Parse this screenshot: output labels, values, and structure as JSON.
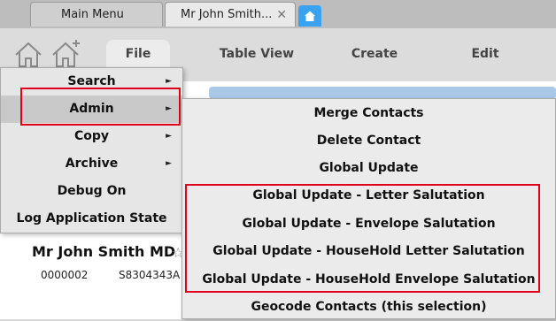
{
  "tabs": [
    {
      "label": "Main Menu"
    },
    {
      "label": "Mr John Smith...",
      "close": "✕"
    }
  ],
  "toolbar": {
    "menus": [
      "File",
      "Table View",
      "Create",
      "Edit"
    ]
  },
  "file_menu": {
    "items": [
      {
        "label": "Search"
      },
      {
        "label": "Admin"
      },
      {
        "label": "Copy"
      },
      {
        "label": "Archive"
      },
      {
        "label": "Debug On"
      },
      {
        "label": "Log Application State"
      }
    ],
    "submenu_arrow": "►"
  },
  "admin_submenu": {
    "items": [
      {
        "label": "Merge Contacts"
      },
      {
        "label": "Delete Contact"
      },
      {
        "label": "Global Update"
      },
      {
        "label": "Global Update - Letter Salutation"
      },
      {
        "label": "Global Update - Envelope Salutation"
      },
      {
        "label": "Global Update - HouseHold Letter Salutation"
      },
      {
        "label": "Global Update - HouseHold Envelope Salutation"
      },
      {
        "label": "Geocode Contacts (this selection)"
      }
    ]
  },
  "contact": {
    "name": "Mr John Smith MD",
    "star": "☆",
    "id": "0000002",
    "code": "S8304343A"
  },
  "colors": {
    "highlight_border": "#e0001b",
    "home_tab": "#3ba2f0"
  }
}
